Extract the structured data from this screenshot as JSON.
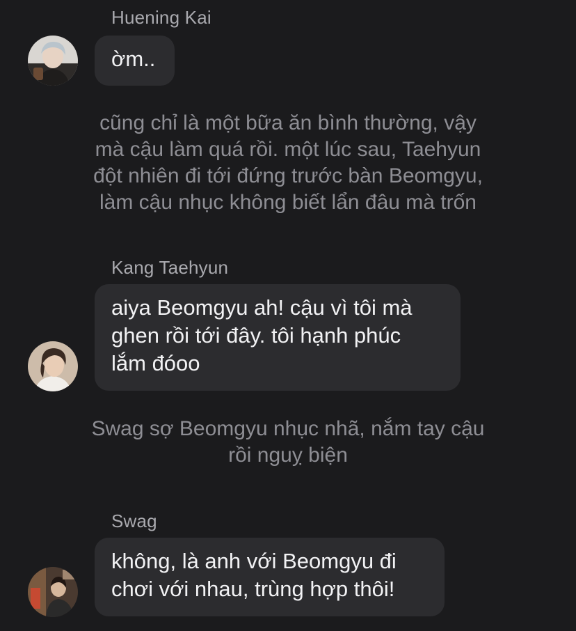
{
  "messages": [
    {
      "sender": "Huening Kai",
      "text": "ờm..",
      "avatar_icon": "user-photo-avatar"
    },
    {
      "narration": "cũng chỉ là một bữa ăn bình thường, vậy\nmà cậu làm quá rồi. một lúc sau, Taehyun\nđột nhiên đi tới đứng trước bàn Beomgyu,\nlàm cậu nhục không biết lẩn đâu mà trốn"
    },
    {
      "sender": "Kang Taehyun",
      "text": "aiya Beomgyu ah! cậu vì tôi mà\nghen rồi tới đây. tôi hạnh phúc\nlắm đóoo",
      "avatar_icon": "user-photo-avatar"
    },
    {
      "narration": "Swag sợ Beomgyu nhục nhã, nắm tay cậu\nrồi nguỵ biện"
    },
    {
      "sender": "Swag",
      "text": "không, là anh với Beomgyu đi\nchơi với nhau, trùng hợp thôi!",
      "avatar_icon": "user-photo-avatar"
    }
  ],
  "colors": {
    "background": "#1b1b1d",
    "bubble": "#2c2c2f",
    "sender_name": "#a9a9ae",
    "narration": "#8e8e94",
    "message_text": "#f2f2f4"
  }
}
